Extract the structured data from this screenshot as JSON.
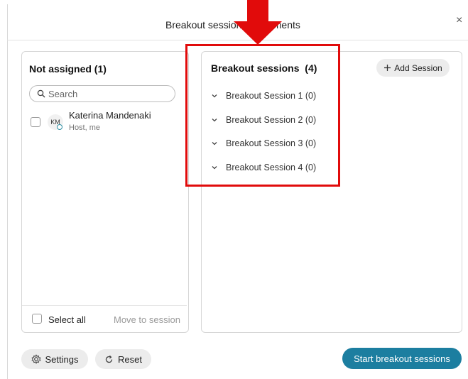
{
  "dialog": {
    "title": "Breakout session assignments",
    "close_glyph": "×"
  },
  "not_assigned": {
    "title": "Not assigned (1)",
    "search_placeholder": "Search",
    "members": [
      {
        "initials": "KM",
        "name": "Katerina Mandenaki",
        "role": "Host, me"
      }
    ],
    "select_all_label": "Select all",
    "move_to_label": "Move to session"
  },
  "breakout": {
    "title": "Breakout sessions  (4)",
    "add_session_label": "Add Session",
    "sessions": [
      {
        "label": "Breakout Session 1 (0)"
      },
      {
        "label": "Breakout Session 2 (0)"
      },
      {
        "label": "Breakout Session 3 (0)"
      },
      {
        "label": "Breakout Session 4 (0)"
      }
    ]
  },
  "footer": {
    "settings_label": "Settings",
    "reset_label": "Reset",
    "start_label": "Start breakout sessions"
  },
  "annotation": {
    "highlight_color": "#e10b0b"
  },
  "colors": {
    "primary": "#1c7ea0",
    "accent_status": "#2f8fa3"
  }
}
